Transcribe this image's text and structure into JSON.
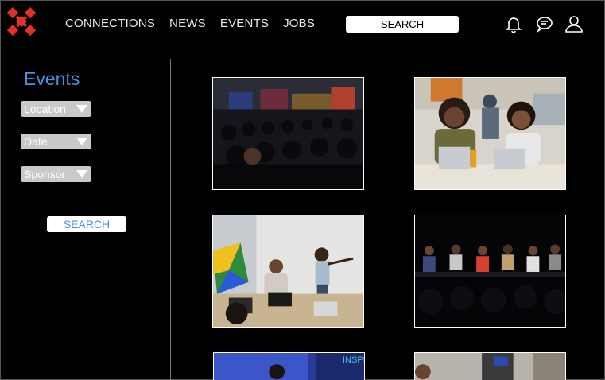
{
  "header": {
    "nav": [
      "CONNECTIONS",
      "NEWS",
      "EVENTS",
      "JOBS"
    ],
    "search_label": "SEARCH"
  },
  "sidebar": {
    "title": "Events",
    "filters": [
      "Location",
      "Date",
      "Sponsor"
    ],
    "search_label": "SEARCH"
  },
  "photos": [
    {
      "name": "event-photo-audience"
    },
    {
      "name": "event-photo-women-laptops"
    },
    {
      "name": "event-photo-presenter-whiteboard"
    },
    {
      "name": "event-photo-panel-stage"
    },
    {
      "name": "event-photo-speakers-screen",
      "text": "INSPI"
    },
    {
      "name": "event-photo-meeting"
    }
  ],
  "colors": {
    "accent": "#4a90e2",
    "logo": "#e0322b"
  }
}
